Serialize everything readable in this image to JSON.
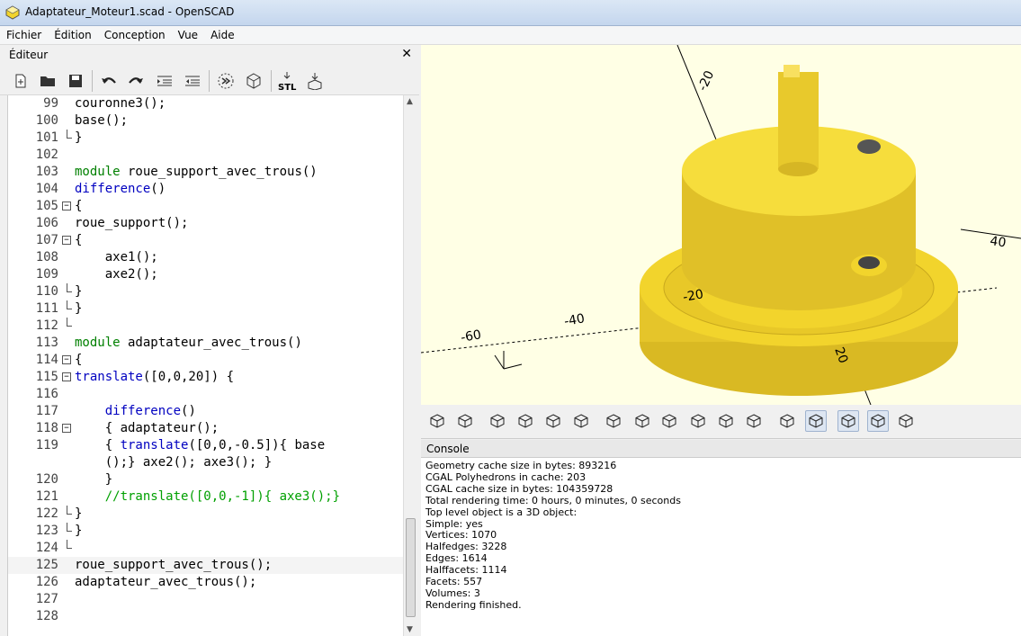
{
  "window": {
    "title": "Adaptateur_Moteur1.scad - OpenSCAD"
  },
  "menu": [
    "Fichier",
    "Édition",
    "Conception",
    "Vue",
    "Aide"
  ],
  "editor": {
    "label": "Éditeur",
    "close": "✕",
    "toolbar": [
      "new-icon",
      "open-icon",
      "save-icon",
      "undo-icon",
      "redo-icon",
      "indent-icon",
      "unindent-icon",
      "preview-icon",
      "render-icon",
      "export-stl-icon",
      "send-icon"
    ],
    "stl_label": "STL",
    "lines": [
      {
        "n": "99",
        "code": "couronne3();",
        "fold": ""
      },
      {
        "n": "100",
        "code": "base();",
        "fold": ""
      },
      {
        "n": "101",
        "code": "}",
        "fold": "end"
      },
      {
        "n": "102",
        "code": "",
        "fold": ""
      },
      {
        "n": "103",
        "code": "module roue_support_avec_trous()",
        "fold": ""
      },
      {
        "n": "104",
        "code": "difference()",
        "fold": ""
      },
      {
        "n": "105",
        "code": "{",
        "fold": "box"
      },
      {
        "n": "106",
        "code": "roue_support();",
        "fold": ""
      },
      {
        "n": "107",
        "code": "{",
        "fold": "box"
      },
      {
        "n": "108",
        "code": "    axe1();",
        "fold": ""
      },
      {
        "n": "109",
        "code": "    axe2();",
        "fold": ""
      },
      {
        "n": "110",
        "code": "}",
        "fold": "end"
      },
      {
        "n": "111",
        "code": "}",
        "fold": "end"
      },
      {
        "n": "112",
        "code": "",
        "fold": "end"
      },
      {
        "n": "113",
        "code": "module adaptateur_avec_trous()",
        "fold": ""
      },
      {
        "n": "114",
        "code": "{",
        "fold": "box"
      },
      {
        "n": "115",
        "code": "translate([0,0,20]) {",
        "fold": "box"
      },
      {
        "n": "116",
        "code": "",
        "fold": ""
      },
      {
        "n": "117",
        "code": "    difference()",
        "fold": ""
      },
      {
        "n": "118",
        "code": "    { adaptateur();",
        "fold": "box"
      },
      {
        "n": "119",
        "code": "    { translate([0,0,-0.5]){ base",
        "fold": ""
      },
      {
        "n": "",
        "code": "    ();} axe2(); axe3(); }",
        "fold": ""
      },
      {
        "n": "120",
        "code": "    }",
        "fold": ""
      },
      {
        "n": "121",
        "code": "    //translate([0,0,-1]){ axe3();}",
        "fold": ""
      },
      {
        "n": "122",
        "code": "}",
        "fold": "end"
      },
      {
        "n": "123",
        "code": "}",
        "fold": "end"
      },
      {
        "n": "124",
        "code": "",
        "fold": "end"
      },
      {
        "n": "125",
        "code": "roue_support_avec_trous();",
        "fold": ""
      },
      {
        "n": "126",
        "code": "adaptateur_avec_trous();",
        "fold": ""
      },
      {
        "n": "127",
        "code": "",
        "fold": ""
      },
      {
        "n": "128",
        "code": "",
        "fold": ""
      }
    ]
  },
  "viewport": {
    "axis_labels": [
      "-20",
      "-40",
      "-60",
      "40",
      "-20",
      "20"
    ],
    "bg_color": "#ffffe5",
    "model_color": "#f2d42c"
  },
  "view_toolbar": [
    "preview-icon",
    "render-icon",
    "view-all-icon",
    "zoom-in-icon",
    "zoom-out-icon",
    "reset-view-icon",
    "view-right-icon",
    "view-top-icon",
    "view-bottom-icon",
    "view-left-icon",
    "view-front-icon",
    "view-back-icon",
    "perspective-icon",
    "orthogonal-icon",
    "show-axes-icon",
    "show-scale-icon",
    "show-edges-icon"
  ],
  "console": {
    "label": "Console",
    "lines": [
      "Geometry cache size in bytes: 893216",
      "CGAL Polyhedrons in cache: 203",
      "CGAL cache size in bytes: 104359728",
      "Total rendering time: 0 hours, 0 minutes, 0 seconds",
      "Top level object is a 3D object:",
      "Simple: yes",
      "Vertices: 1070",
      "Halfedges: 3228",
      "Edges: 1614",
      "Halffacets: 1114",
      "Facets: 557",
      "Volumes: 3",
      "Rendering finished."
    ]
  }
}
